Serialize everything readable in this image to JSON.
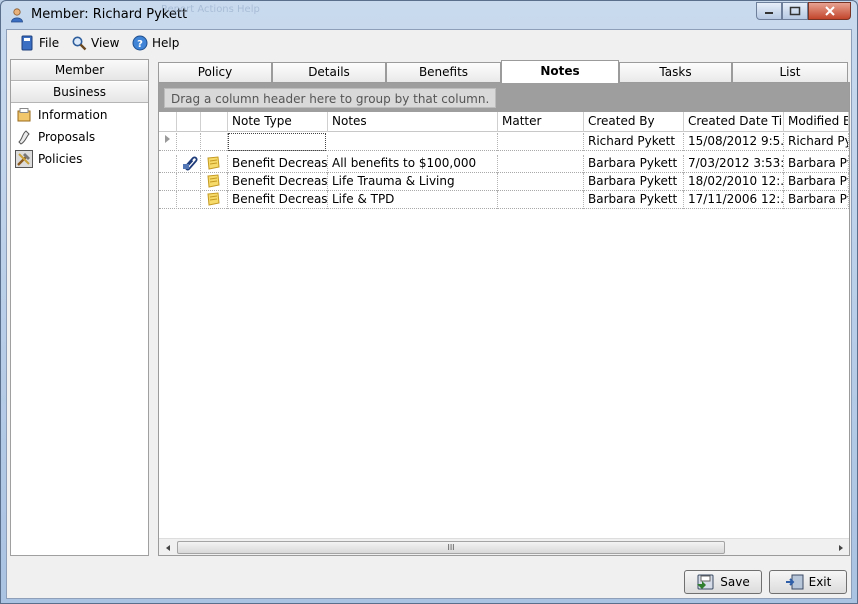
{
  "window": {
    "title": "Member: Richard Pykett",
    "ghost_text": "Report   Actions   Help"
  },
  "menu": [
    {
      "label": "File",
      "icon": "file-icon"
    },
    {
      "label": "View",
      "icon": "view-icon"
    },
    {
      "label": "Help",
      "icon": "help-icon"
    }
  ],
  "left_panel": {
    "member_button": "Member",
    "business_button": "Business",
    "items": [
      {
        "label": "Information",
        "icon": "information-icon"
      },
      {
        "label": "Proposals",
        "icon": "proposals-icon"
      },
      {
        "label": "Policies",
        "icon": "policies-icon",
        "selected": true
      }
    ]
  },
  "tabs": [
    "Policy",
    "Details",
    "Benefits",
    "Notes",
    "Tasks",
    "List"
  ],
  "active_tab": "Notes",
  "grid": {
    "group_hint": "Drag a column header here to group by that column.",
    "columns": [
      "Note Type",
      "Notes",
      "Matter",
      "Created By",
      "Created Date Time",
      "Modified By"
    ],
    "new_row": {
      "created_by": "Richard Pykett",
      "created": "15/08/2012 9:5...",
      "modified_by": "Richard Pykett"
    },
    "rows": [
      {
        "attachment": true,
        "note_type": "Benefit Decreased",
        "notes": "All benefits to $100,000",
        "matter": "",
        "created_by": "Barbara Pykett",
        "created": "7/03/2012 3:53:...",
        "modified_by": "Barbara Pykett"
      },
      {
        "attachment": false,
        "note_type": "Benefit Decreased",
        "notes": "Life Trauma & Living",
        "matter": "",
        "created_by": "Barbara Pykett",
        "created": "18/02/2010 12:...",
        "modified_by": "Barbara Pykett"
      },
      {
        "attachment": false,
        "note_type": "Benefit Decreased",
        "notes": "Life & TPD",
        "matter": "",
        "created_by": "Barbara Pykett",
        "created": "17/11/2006 12:...",
        "modified_by": "Barbara Pykett"
      }
    ],
    "scroll_grip": "III"
  },
  "buttons": {
    "save": "Save",
    "exit": "Exit"
  }
}
